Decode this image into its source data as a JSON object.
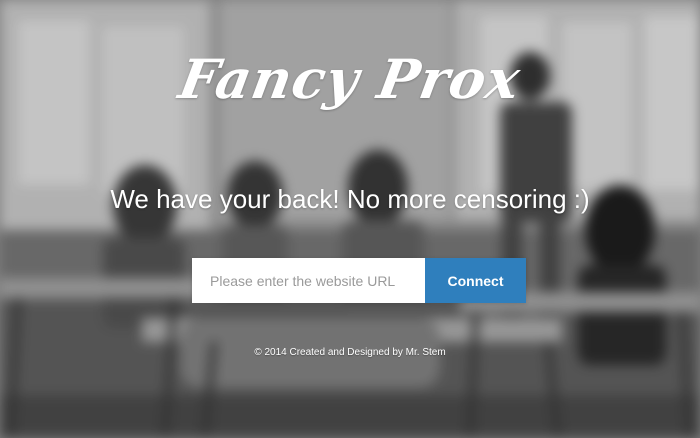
{
  "brand": {
    "logo_text": "Fancy Prox"
  },
  "hero": {
    "tagline": "We have your back! No more censoring :)"
  },
  "form": {
    "url_placeholder": "Please enter the website URL",
    "url_value": "",
    "connect_label": "Connect"
  },
  "footer": {
    "credit": "© 2014 Created and Designed by Mr. Stem"
  },
  "colors": {
    "accent": "#2f7fbd",
    "text": "#ffffff"
  }
}
